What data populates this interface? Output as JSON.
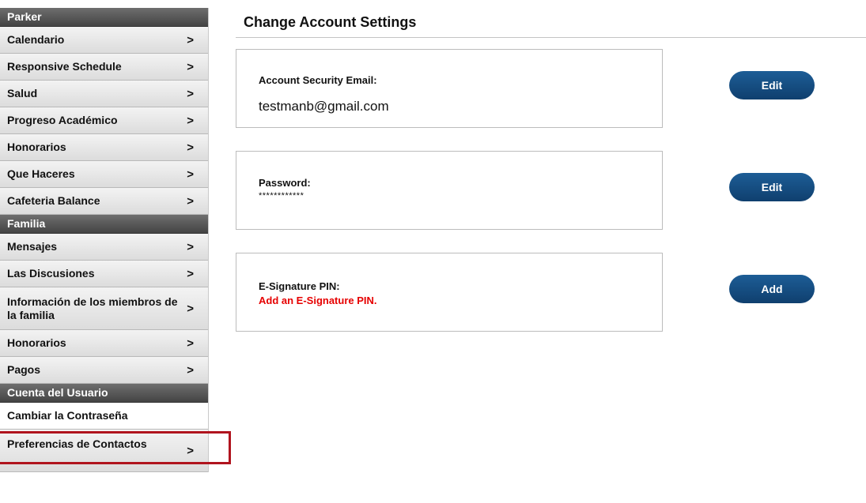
{
  "sidebar": {
    "sections": [
      {
        "header": "Parker",
        "items": [
          {
            "label": "Calendario",
            "chevron": true
          },
          {
            "label": "Responsive Schedule",
            "chevron": true
          },
          {
            "label": "Salud",
            "chevron": true
          },
          {
            "label": "Progreso Académico",
            "chevron": true
          },
          {
            "label": "Honorarios",
            "chevron": true
          },
          {
            "label": "Que Haceres",
            "chevron": true
          },
          {
            "label": "Cafeteria Balance",
            "chevron": true
          }
        ]
      },
      {
        "header": "Familia",
        "items": [
          {
            "label": "Mensajes",
            "chevron": true
          },
          {
            "label": "Las Discusiones",
            "chevron": true
          },
          {
            "label": "Información de los miembros de la familia",
            "chevron": true
          },
          {
            "label": "Honorarios",
            "chevron": true
          },
          {
            "label": "Pagos",
            "chevron": true
          }
        ]
      },
      {
        "header": "Cuenta del Usuario",
        "items": [
          {
            "label": "Cambiar la Contraseña",
            "chevron": false,
            "active": true
          },
          {
            "label": "Preferencias de Contactos",
            "chevron": true
          }
        ]
      }
    ],
    "chevron_glyph": ">"
  },
  "main": {
    "title": "Change Account Settings",
    "cards": {
      "email": {
        "label": "Account Security Email:",
        "value": "testmanb@gmail.com",
        "button": "Edit"
      },
      "password": {
        "label": "Password:",
        "value": "************",
        "button": "Edit"
      },
      "pin": {
        "label": "E-Signature PIN:",
        "value": "Add an E-Signature PIN.",
        "button": "Add"
      }
    }
  },
  "colors": {
    "accent_button": "#1a5a92",
    "warning_text": "#e60000",
    "highlight_box": "#b0141e"
  }
}
